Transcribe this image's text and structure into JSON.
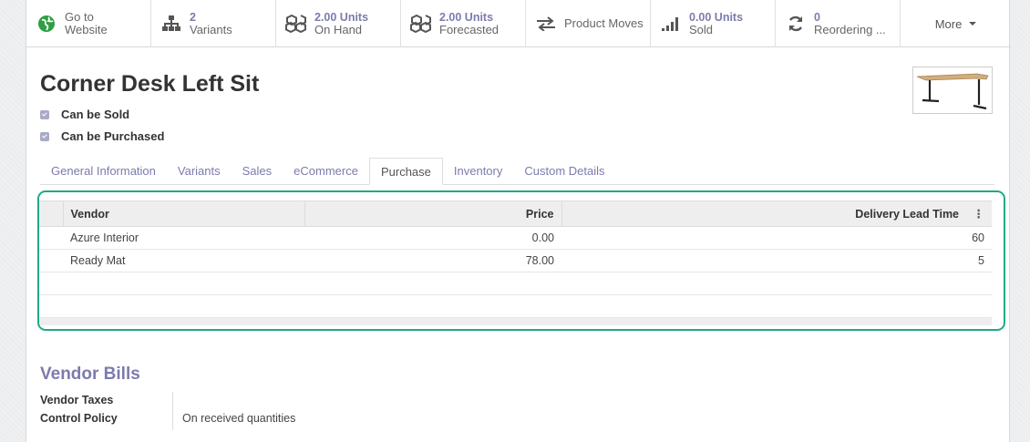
{
  "colors": {
    "accent": "#7c7bad",
    "highlight": "#21a987",
    "globe": "#2f9e44"
  },
  "stat_buttons": [
    {
      "icon": "globe-icon",
      "value": "",
      "label": "Go to\nWebsite"
    },
    {
      "icon": "sitemap-icon",
      "value": "2",
      "label": "Variants"
    },
    {
      "icon": "cubes-icon",
      "value": "2.00 Units",
      "label": "On Hand"
    },
    {
      "icon": "cubes-icon",
      "value": "2.00 Units",
      "label": "Forecasted"
    },
    {
      "icon": "exchange-icon",
      "value": "",
      "label": "Product Moves"
    },
    {
      "icon": "signal-icon",
      "value": "0.00 Units",
      "label": "Sold"
    },
    {
      "icon": "refresh-icon",
      "value": "0",
      "label": "Reordering ..."
    },
    {
      "icon": "caret-down-icon",
      "value": "",
      "label": "More"
    }
  ],
  "product": {
    "name": "Corner Desk Left Sit",
    "can_be_sold": "Can be Sold",
    "can_be_purchased": "Can be Purchased"
  },
  "tabs": [
    {
      "label": "General Information"
    },
    {
      "label": "Variants"
    },
    {
      "label": "Sales"
    },
    {
      "label": "eCommerce"
    },
    {
      "label": "Purchase",
      "active": true
    },
    {
      "label": "Inventory"
    },
    {
      "label": "Custom Details"
    }
  ],
  "vendor_table": {
    "headers": {
      "vendor": "Vendor",
      "price": "Price",
      "delivery": "Delivery Lead Time"
    },
    "rows": [
      {
        "vendor": "Azure Interior",
        "price": "0.00",
        "delivery": "60"
      },
      {
        "vendor": "Ready Mat",
        "price": "78.00",
        "delivery": "5"
      }
    ]
  },
  "vendor_bills": {
    "title": "Vendor Bills",
    "taxes_label": "Vendor Taxes",
    "policy_label": "Control Policy",
    "policy_value": "On received quantities"
  }
}
